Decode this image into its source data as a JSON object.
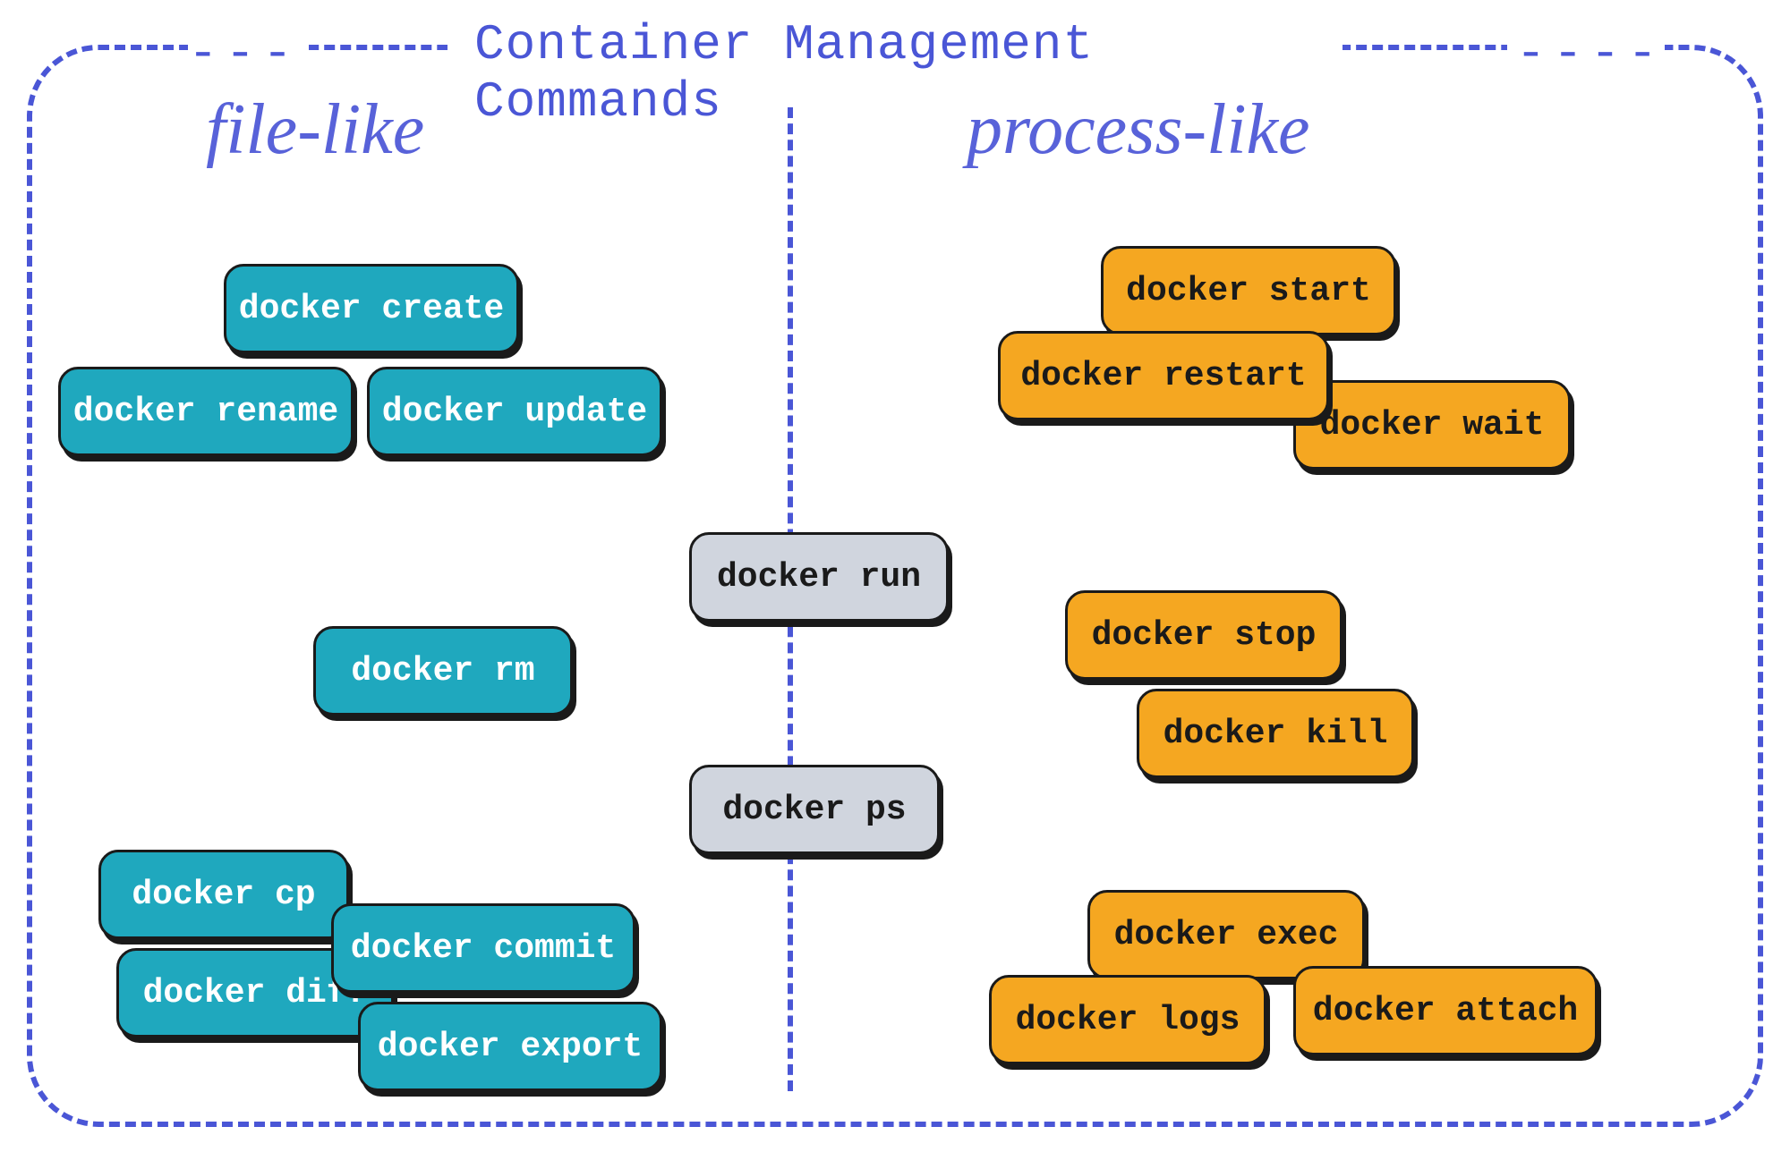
{
  "title": "Container Management Commands",
  "sections": {
    "left": "file-like",
    "right": "process-like"
  },
  "fileLike": {
    "create": "docker create",
    "rename": "docker rename",
    "update": "docker update",
    "rm": "docker rm",
    "cp": "docker cp",
    "diff": "docker diff",
    "commit": "docker commit",
    "export": "docker export"
  },
  "processLike": {
    "start": "docker start",
    "restart": "docker restart",
    "wait": "docker wait",
    "stop": "docker stop",
    "kill": "docker kill",
    "exec": "docker exec",
    "logs": "docker logs",
    "attach": "docker attach"
  },
  "center": {
    "run": "docker run",
    "ps": "docker ps"
  },
  "colors": {
    "teal": "#1fa8be",
    "amber": "#f5a721",
    "gray": "#d0d5de",
    "border": "#4a56d6"
  }
}
